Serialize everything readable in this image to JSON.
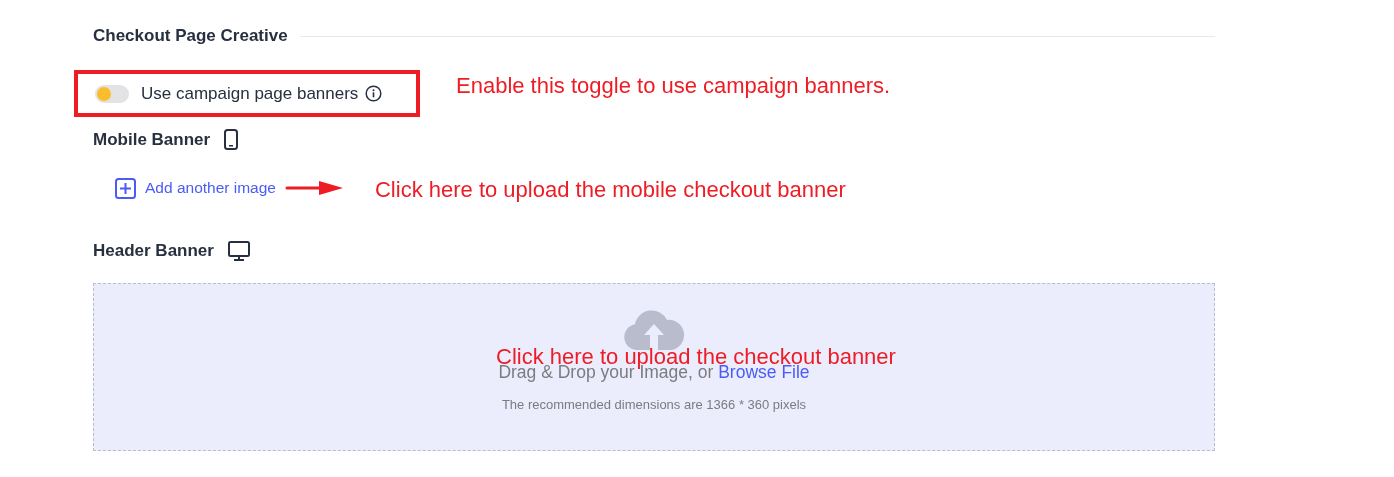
{
  "section": {
    "title": "Checkout Page Creative"
  },
  "toggle": {
    "label": "Use campaign page banners",
    "on": false,
    "highlighted": true
  },
  "mobile_banner": {
    "title": "Mobile Banner",
    "add_link": "Add another image"
  },
  "header_banner": {
    "title": "Header Banner",
    "dropzone": {
      "prompt": "Drag & Drop your Image, or ",
      "browse_link": "Browse File",
      "hint": "The recommended dimensions are 1366 * 360 pixels"
    }
  },
  "annotations": [
    {
      "kind": "toggle",
      "text": "Enable this toggle to use campaign banners."
    },
    {
      "kind": "mobile",
      "text": "Click here to upload the mobile checkout banner"
    },
    {
      "kind": "dropzone",
      "text": "Click here to upload the checkout banner"
    }
  ]
}
